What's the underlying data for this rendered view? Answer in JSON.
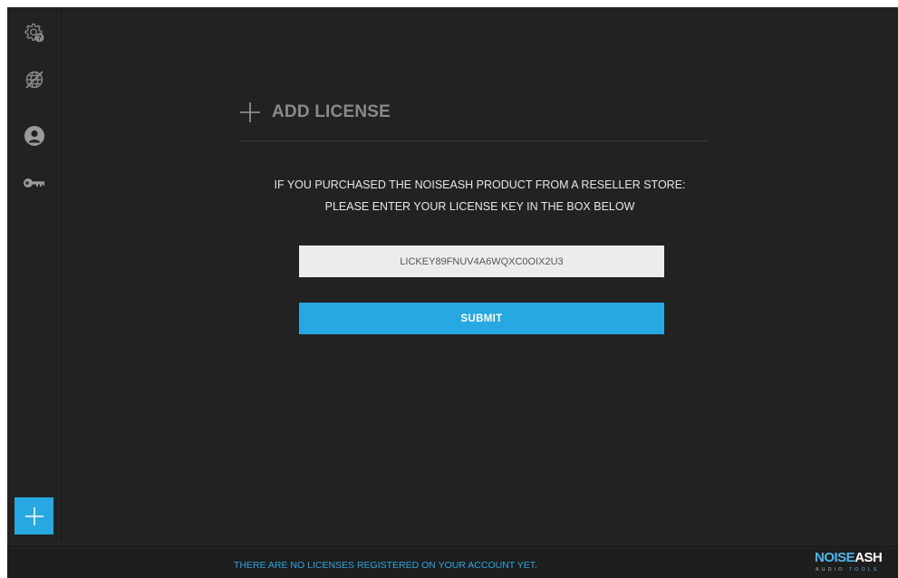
{
  "sidebar": {
    "icons": [
      {
        "name": "settings-help-icon"
      },
      {
        "name": "offline-globe-icon"
      },
      {
        "name": "user-account-icon"
      },
      {
        "name": "license-key-icon"
      }
    ],
    "add_button_icon": "plus-icon"
  },
  "main": {
    "title": "ADD LICENSE",
    "title_icon": "plus-icon",
    "instruction_line1": "IF YOU PURCHASED THE NOISEASH PRODUCT FROM A RESELLER STORE:",
    "instruction_line2": "PLEASE ENTER YOUR LICENSE KEY IN THE BOX BELOW",
    "license_input_value": "LICKEY89FNUV4A6WQXC0OIX2U3",
    "submit_label": "SUBMIT"
  },
  "footer": {
    "status_text": "THERE ARE NO LICENSES REGISTERED ON YOUR ACCOUNT YET.",
    "brand_noise": "NOISE",
    "brand_ash": "ASH",
    "brand_tagline_audio": "AUDIO",
    "brand_tagline_tools": "TOOLS"
  },
  "colors": {
    "background": "#222222",
    "accent": "#28a8e0",
    "input_bg": "#ececec",
    "heading": "#8a8a8a",
    "text": "#e6e6e6"
  }
}
